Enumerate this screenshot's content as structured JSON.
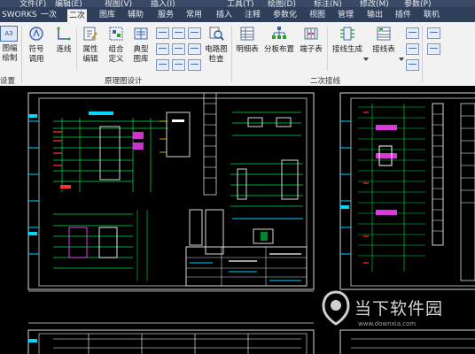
{
  "menubar": {
    "items": [
      "文件(F)",
      "编辑(E)",
      "视图(V)",
      "插入(I)",
      "工具(T)",
      "绘图(D)",
      "标注(N)",
      "修改(M)",
      "参数(P)"
    ]
  },
  "tabs": {
    "items": [
      "SWORKS",
      "一次",
      "二次",
      "图库",
      "辅助",
      "服务",
      "常用",
      "插入",
      "注释",
      "参数化",
      "视图",
      "管理",
      "输出",
      "插件",
      "联机"
    ],
    "active": "二次"
  },
  "ribbon": {
    "left_stub": {
      "icon_text": "A3",
      "label1": "图幅",
      "label2": "绘制",
      "group": "设置"
    },
    "buttons": [
      {
        "id": "symbol",
        "l1": "符号",
        "l2": "调用"
      },
      {
        "id": "connect",
        "l1": "连线",
        "l2": ""
      },
      {
        "id": "attr",
        "l1": "属性",
        "l2": "编辑"
      },
      {
        "id": "group",
        "l1": "组合",
        "l2": "定义"
      },
      {
        "id": "typical",
        "l1": "典型",
        "l2": "图库"
      },
      {
        "id": "circuit-check",
        "l1": "电路图",
        "l2": "检查"
      },
      {
        "id": "detail-table",
        "l1": "明细表",
        "l2": ""
      },
      {
        "id": "panel-layout",
        "l1": "分板布置",
        "l2": ""
      },
      {
        "id": "terminal-table",
        "l1": "端子表",
        "l2": ""
      },
      {
        "id": "wiring-gen",
        "l1": "接线生成",
        "l2": ""
      },
      {
        "id": "wiring-table",
        "l1": "接线表",
        "l2": ""
      }
    ],
    "groups": {
      "schematic": "原理图设计",
      "secondary_wiring": "二次接线"
    }
  },
  "watermark": {
    "text": "当下软件园",
    "url": "www.downxia.com"
  },
  "colors": {
    "ribbon_bg": "#f2f2f2",
    "tabbar_bg": "#2f3e59",
    "canvas_bg": "#000000",
    "frame": "#d8d8d8",
    "cyan": "#00d6ff",
    "green": "#00e04b",
    "red": "#ff3030",
    "magenta": "#ff40ff",
    "yellow": "#ffe100"
  }
}
